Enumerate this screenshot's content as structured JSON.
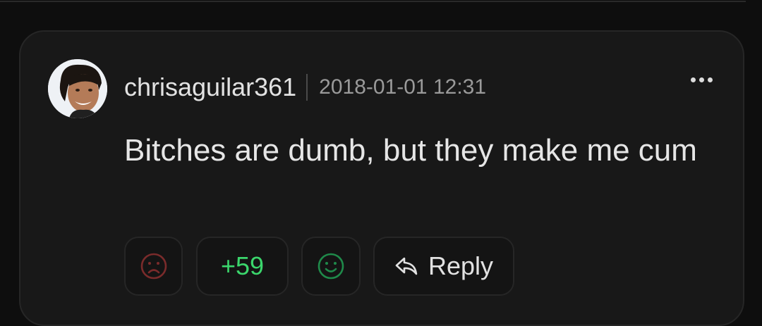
{
  "comment": {
    "username": "chrisaguilar361",
    "timestamp": "2018-01-01 12:31",
    "text": "Bitches are dumb, but they make me cum",
    "score": "+59"
  },
  "actions": {
    "downvote_icon": "sad-face-icon",
    "upvote_icon": "smiley-face-icon",
    "reply_icon": "reply-arrow-icon",
    "reply_label": "Reply"
  },
  "menu_icon": "more-dots-icon",
  "colors": {
    "background": "#0e0e0e",
    "card": "#181818",
    "score": "#3bd66c",
    "downvote": "#7a2b2b",
    "upvote": "#1f8a4a"
  }
}
